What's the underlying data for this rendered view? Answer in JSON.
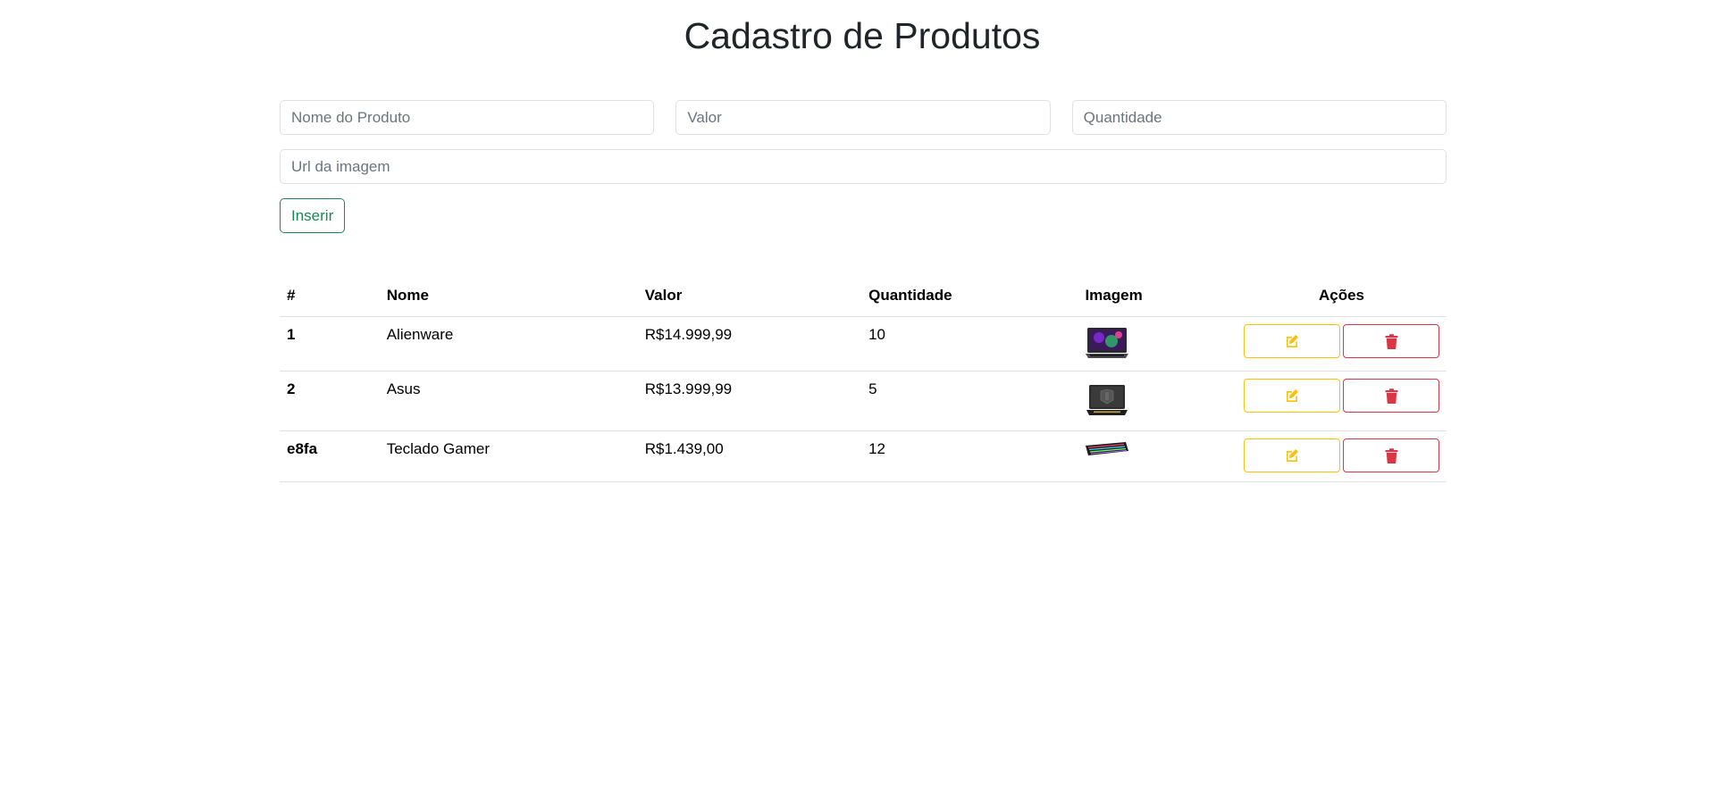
{
  "header": {
    "title": "Cadastro de Produtos"
  },
  "form": {
    "name_placeholder": "Nome do Produto",
    "value_placeholder": "Valor",
    "quantity_placeholder": "Quantidade",
    "url_placeholder": "Url da imagem",
    "insert_label": "Inserir"
  },
  "table": {
    "headers": {
      "id": "#",
      "name": "Nome",
      "value": "Valor",
      "quantity": "Quantidade",
      "image": "Imagem",
      "actions": "Ações"
    },
    "rows": [
      {
        "id": "1",
        "name": "Alienware",
        "value": "R$14.999,99",
        "quantity": "10",
        "image": "laptop-alienware-thumbnail"
      },
      {
        "id": "2",
        "name": "Asus",
        "value": "R$13.999,99",
        "quantity": "5",
        "image": "laptop-asus-thumbnail"
      },
      {
        "id": "e8fa",
        "name": "Teclado Gamer",
        "value": "R$1.439,00",
        "quantity": "12",
        "image": "keyboard-thumbnail"
      }
    ]
  },
  "icons": {
    "edit": "edit-icon",
    "delete": "trash-icon"
  },
  "colors": {
    "success": "#198754",
    "warning": "#ffc107",
    "danger": "#dc3545"
  }
}
